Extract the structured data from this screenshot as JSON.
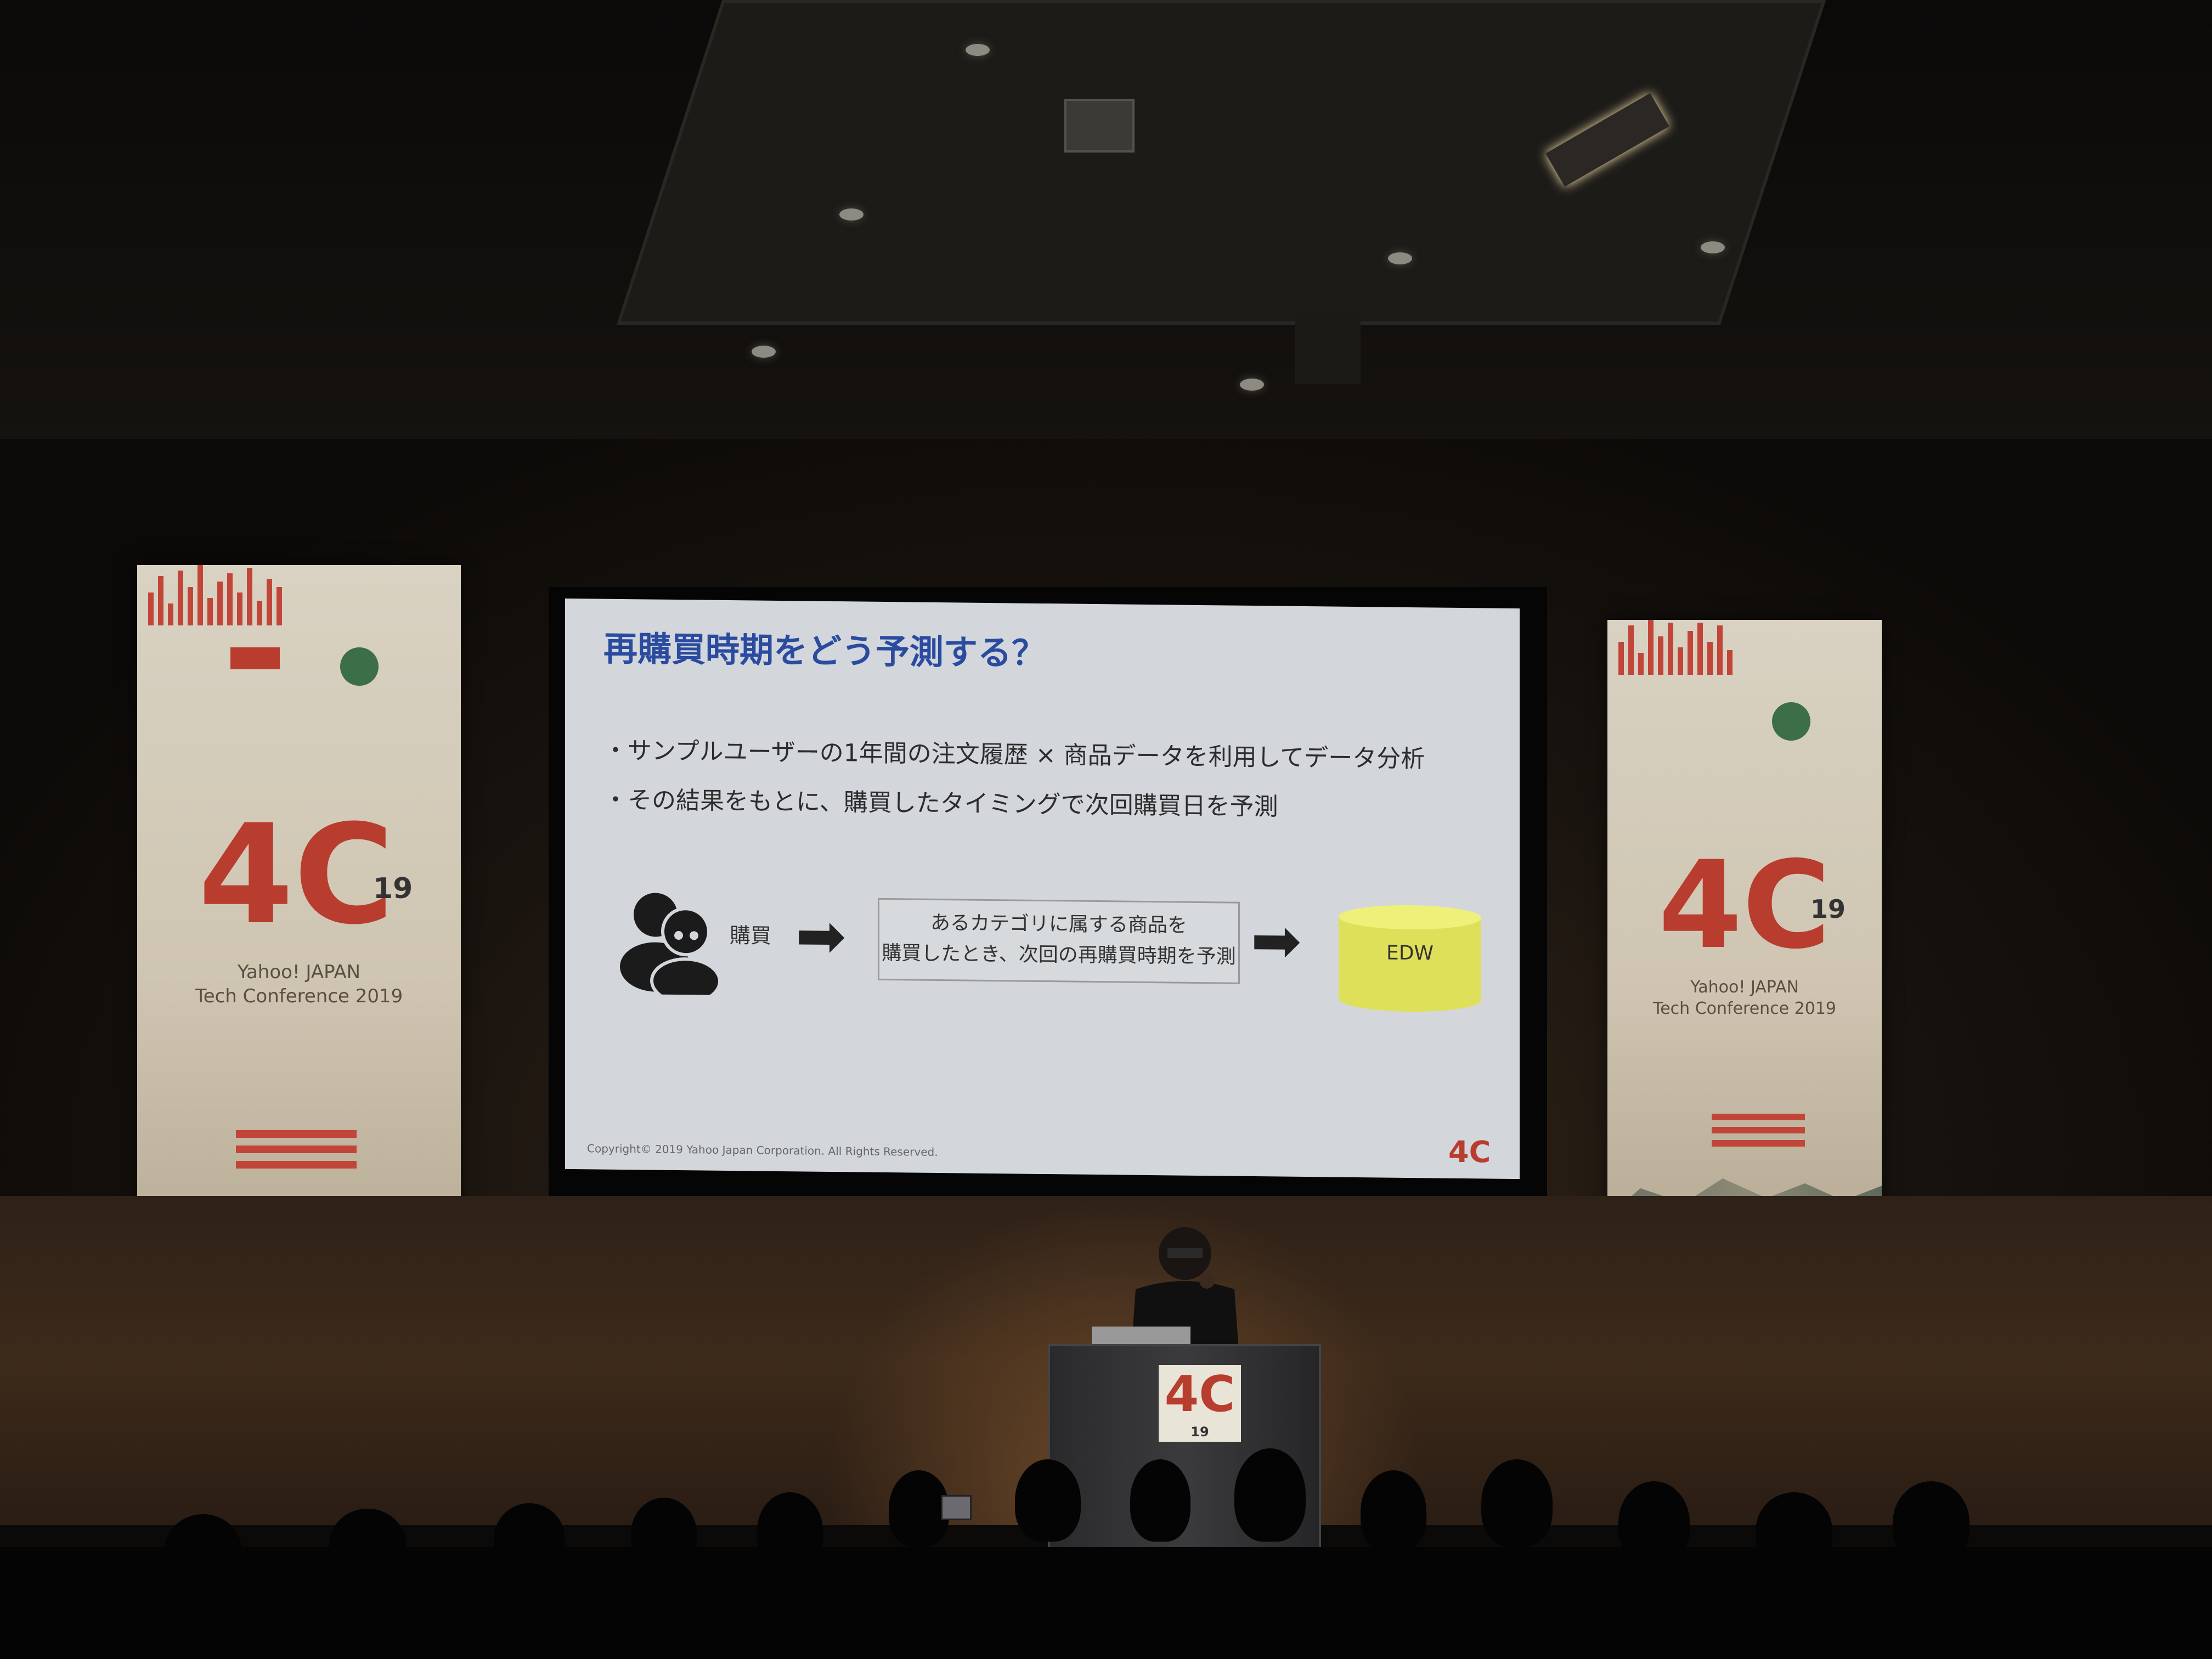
{
  "scene": {
    "description_colors": {
      "slide_title": "#2a4ba0",
      "brand_red": "#b83d2e",
      "edw_yellow": "#e2e45a"
    }
  },
  "slide": {
    "title": "再購買時期をどう予測する？",
    "bullets": [
      "・サンプルユーザーの1年間の注文履歴 × 商品データを利用してデータ分析",
      "・その結果をもとに、購買したタイミングで次回購買日を予測"
    ],
    "flow": {
      "buy_label": "購買",
      "arrow": "➡",
      "description_lines": [
        "あるカテゴリに属する商品を",
        "購買したとき、次回の再購買時期を予測"
      ],
      "db_label": "EDW"
    },
    "copyright": "Copyright© 2019 Yahoo Japan Corporation. All Rights Reserved."
  },
  "banners": {
    "left": {
      "sub_number": "19",
      "line1": "Yahoo! JAPAN",
      "line2": "Tech Conference 2019"
    },
    "right": {
      "sub_number": "19",
      "line1": "Yahoo! JAPAN",
      "line2": "Tech Conference 2019"
    }
  },
  "podium": {
    "sub_number": "19"
  }
}
